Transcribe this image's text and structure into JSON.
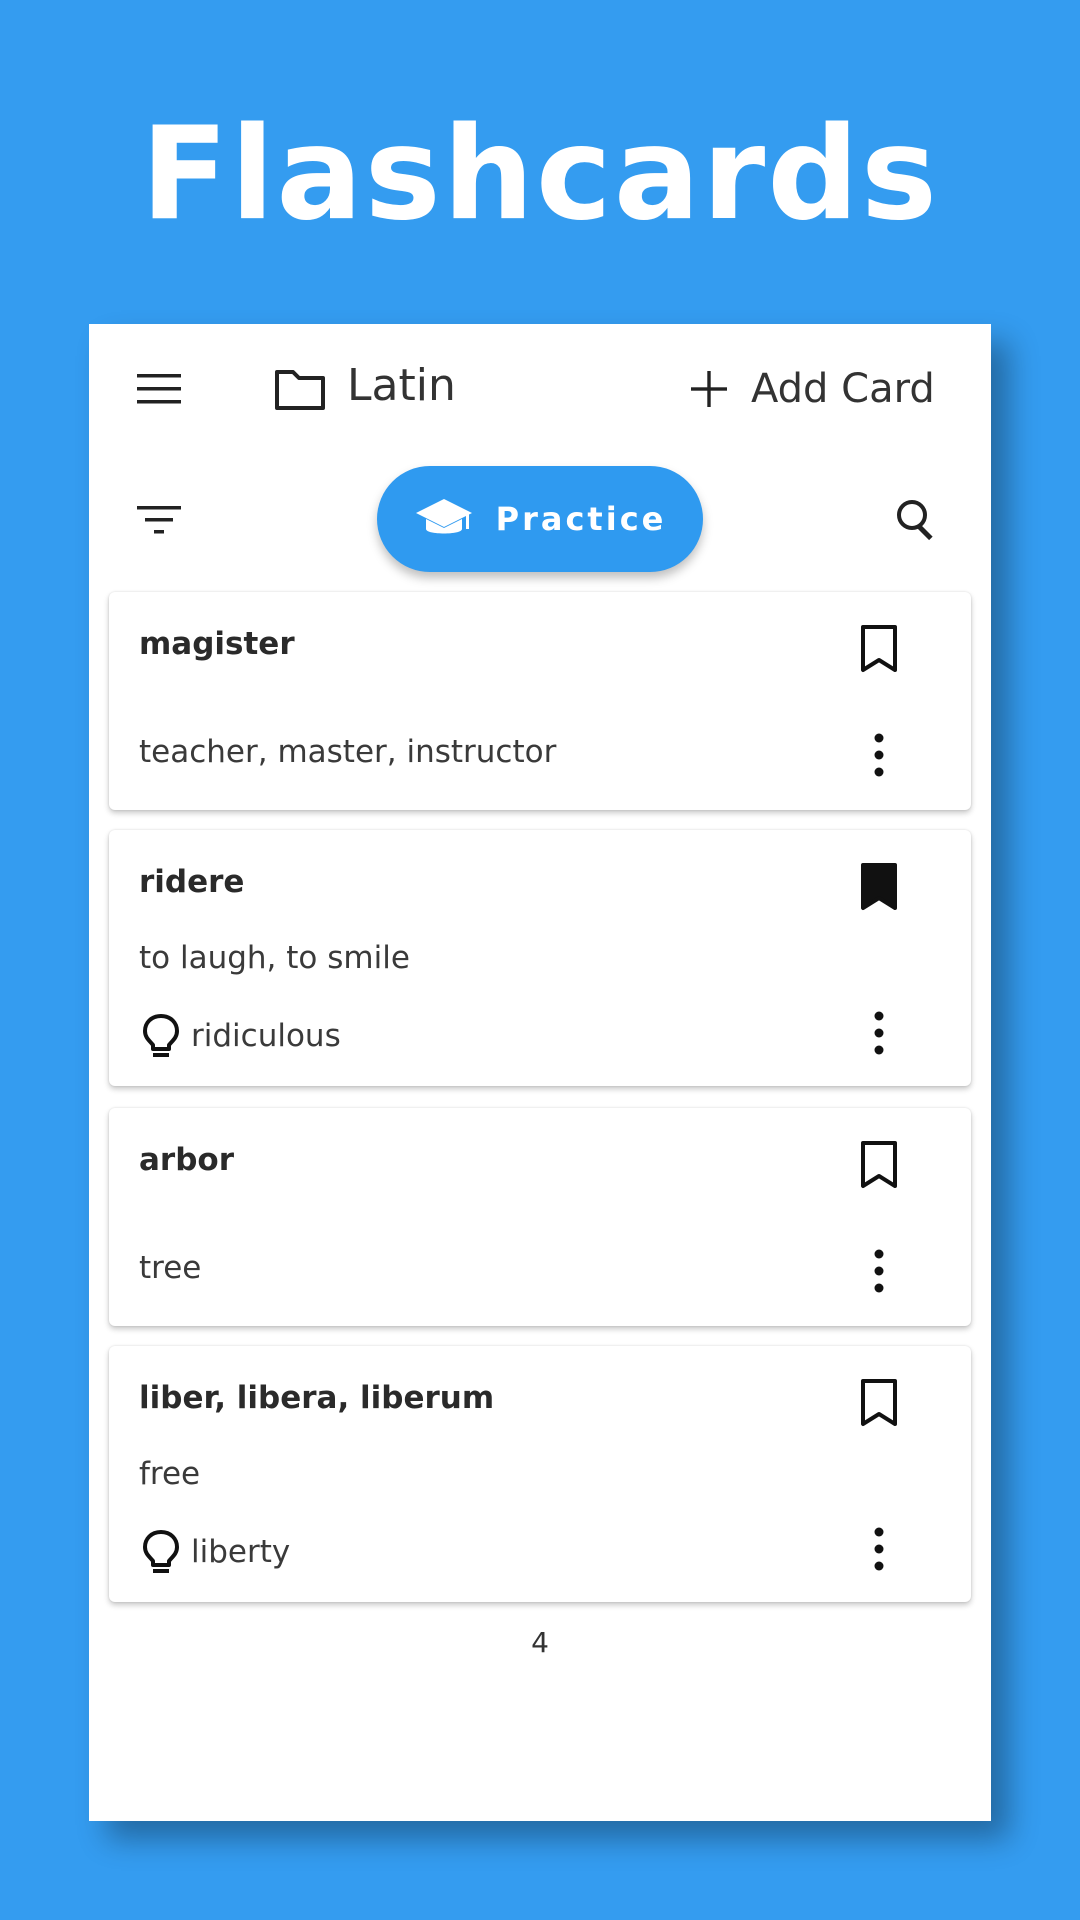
{
  "hero": {
    "title": "Flashcards"
  },
  "topbar": {
    "menu_icon": "menu-icon",
    "folder_icon": "folder-icon",
    "folder_name": "Latin",
    "add_icon": "plus-icon",
    "add_label": "Add Card"
  },
  "toolbar": {
    "filter_icon": "filter-icon",
    "practice_icon": "graduation-cap-icon",
    "practice_label": "Practice",
    "search_icon": "search-icon"
  },
  "cards": [
    {
      "term": "magister",
      "definition": "teacher, master, instructor",
      "hint": "",
      "bookmarked": false
    },
    {
      "term": "ridere",
      "definition": "to laugh, to smile",
      "hint": "ridiculous",
      "bookmarked": true
    },
    {
      "term": "arbor",
      "definition": "tree",
      "hint": "",
      "bookmarked": false
    },
    {
      "term": "liber, libera, liberum",
      "definition": "free",
      "hint": "liberty",
      "bookmarked": false
    }
  ],
  "count": "4",
  "colors": {
    "background": "#349cf0",
    "accent": "#2f9af0",
    "card": "#ffffff"
  }
}
